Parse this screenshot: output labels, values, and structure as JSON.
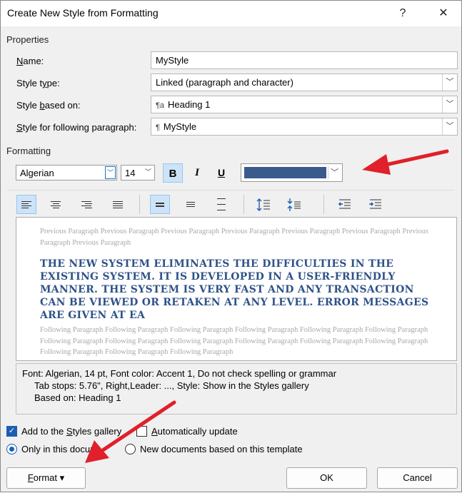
{
  "window": {
    "title": "Create New Style from Formatting",
    "help": "?",
    "close": "✕"
  },
  "properties": {
    "section": "Properties",
    "name_label_u": "N",
    "name_label_rest": "ame:",
    "name_value": "MyStyle",
    "type_label_a": "Style t",
    "type_label_u": "y",
    "type_label_b": "pe:",
    "type_value": "Linked (paragraph and character)",
    "based_label_a": "Style ",
    "based_label_u": "b",
    "based_label_b": "ased on:",
    "based_glyph": "¶a",
    "based_value": "Heading 1",
    "following_label_a": "",
    "following_label_u": "S",
    "following_label_b": "tyle for following paragraph:",
    "following_glyph": "¶",
    "following_value": "MyStyle"
  },
  "formatting": {
    "section": "Formatting",
    "font": "Algerian",
    "size": "14",
    "bold": "B",
    "italic": "I",
    "underline": "U",
    "font_color": "#3a5a8c"
  },
  "preview": {
    "previous": "Previous Paragraph Previous Paragraph Previous Paragraph Previous Paragraph Previous Paragraph Previous Paragraph Previous Paragraph Previous Paragraph",
    "sample": "THE NEW SYSTEM ELIMINATES THE DIFFICULTIES IN THE EXISTING SYSTEM. IT IS DEVELOPED IN A USER-FRIENDLY MANNER. THE SYSTEM IS VERY FAST AND ANY TRANSACTION CAN BE VIEWED OR RETAKEN AT ANY LEVEL. ERROR MESSAGES ARE GIVEN AT EA",
    "following": "Following Paragraph Following Paragraph Following Paragraph Following Paragraph Following Paragraph Following Paragraph Following Paragraph Following Paragraph Following Paragraph Following Paragraph Following Paragraph Following Paragraph Following Paragraph Following Paragraph Following Paragraph"
  },
  "description": {
    "line1": "Font: Algerian, 14 pt, Font color: Accent 1, Do not check spelling or grammar",
    "line2": "Tab stops:  5.76\", Right,Leader: ..., Style: Show in the Styles gallery",
    "line3": "Based on: Heading 1"
  },
  "options": {
    "add_gallery_a": "Add to the ",
    "add_gallery_u": "S",
    "add_gallery_b": "tyles gallery",
    "auto_update_u": "A",
    "auto_update_b": "utomatically update",
    "only_doc_a": "Only in this docu",
    "only_doc_b": "m",
    "new_docs": "New documents based on this template"
  },
  "buttons": {
    "format_u": "F",
    "format_b": "ormat ▾",
    "ok": "OK",
    "cancel": "Cancel"
  },
  "colors": {
    "accent": "#1a5fb4",
    "annotation_arrow": "#e0202a"
  }
}
